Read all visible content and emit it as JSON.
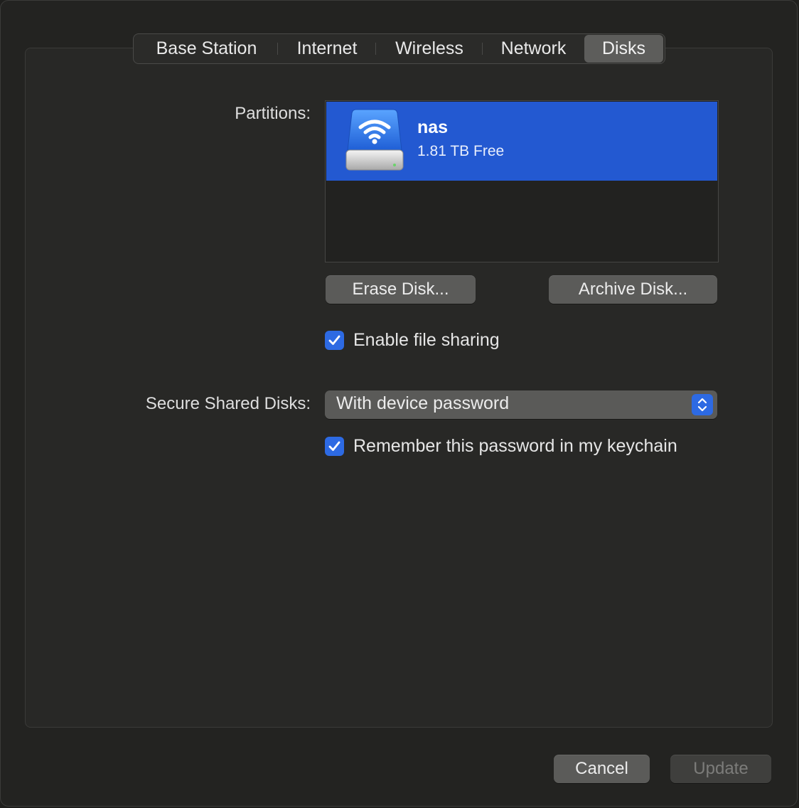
{
  "tabs": [
    {
      "label": "Base Station",
      "active": false
    },
    {
      "label": "Internet",
      "active": false
    },
    {
      "label": "Wireless",
      "active": false
    },
    {
      "label": "Network",
      "active": false
    },
    {
      "label": "Disks",
      "active": true
    }
  ],
  "partitions": {
    "label": "Partitions:",
    "items": [
      {
        "name": "nas",
        "detail": "1.81 TB Free",
        "icon": "airport-disk-icon",
        "selected": true
      }
    ]
  },
  "buttons": {
    "erase_disk": "Erase Disk...",
    "archive_disk": "Archive Disk..."
  },
  "file_sharing": {
    "label": "Enable file sharing",
    "checked": true
  },
  "secure_shared_disks": {
    "label": "Secure Shared Disks:",
    "value": "With device password"
  },
  "remember_password": {
    "label": "Remember this password in my keychain",
    "checked": true
  },
  "footer": {
    "cancel": "Cancel",
    "update": "Update",
    "update_enabled": false
  },
  "colors": {
    "accent": "#2d6ae3",
    "selection": "#2359d1",
    "background": "#232321"
  }
}
